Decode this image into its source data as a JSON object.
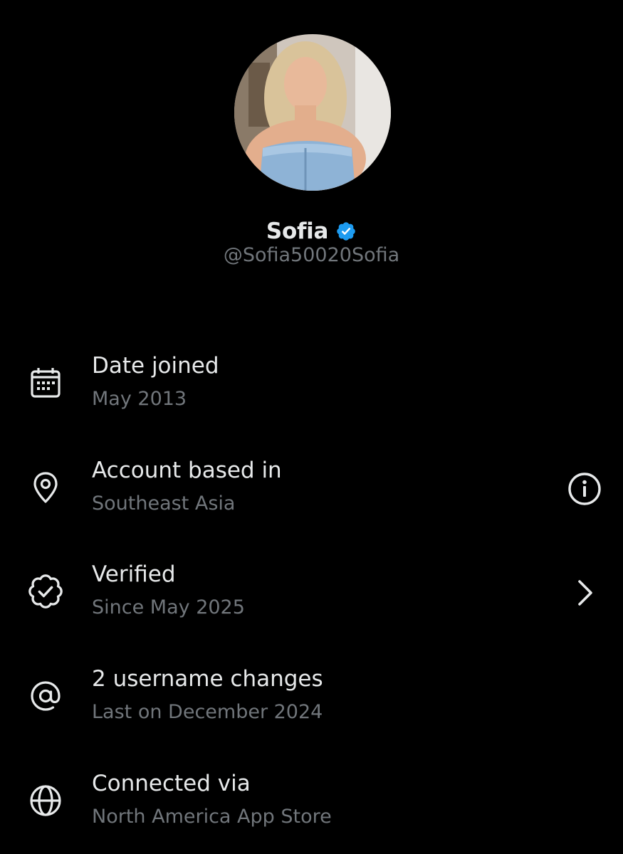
{
  "profile": {
    "display_name": "Sofia",
    "handle": "@Sofia50020Sofia",
    "verified": true,
    "badge_color": "#1d9bf0"
  },
  "about_rows": [
    {
      "icon": "calendar-icon",
      "title": "Date joined",
      "subtitle": "May 2013",
      "action": null
    },
    {
      "icon": "location-pin-icon",
      "title": "Account based in",
      "subtitle": "Southeast Asia",
      "action": "info-icon"
    },
    {
      "icon": "verified-badge-icon",
      "title": "Verified",
      "subtitle": "Since May 2025",
      "action": "chevron-right-icon"
    },
    {
      "icon": "at-sign-icon",
      "title": "2 username changes",
      "subtitle": "Last on December 2024",
      "action": null
    },
    {
      "icon": "globe-icon",
      "title": "Connected via",
      "subtitle": "North America App Store",
      "action": null
    }
  ],
  "colors": {
    "background": "#000000",
    "primary_text": "#e7e9ea",
    "secondary_text": "#71767b"
  }
}
